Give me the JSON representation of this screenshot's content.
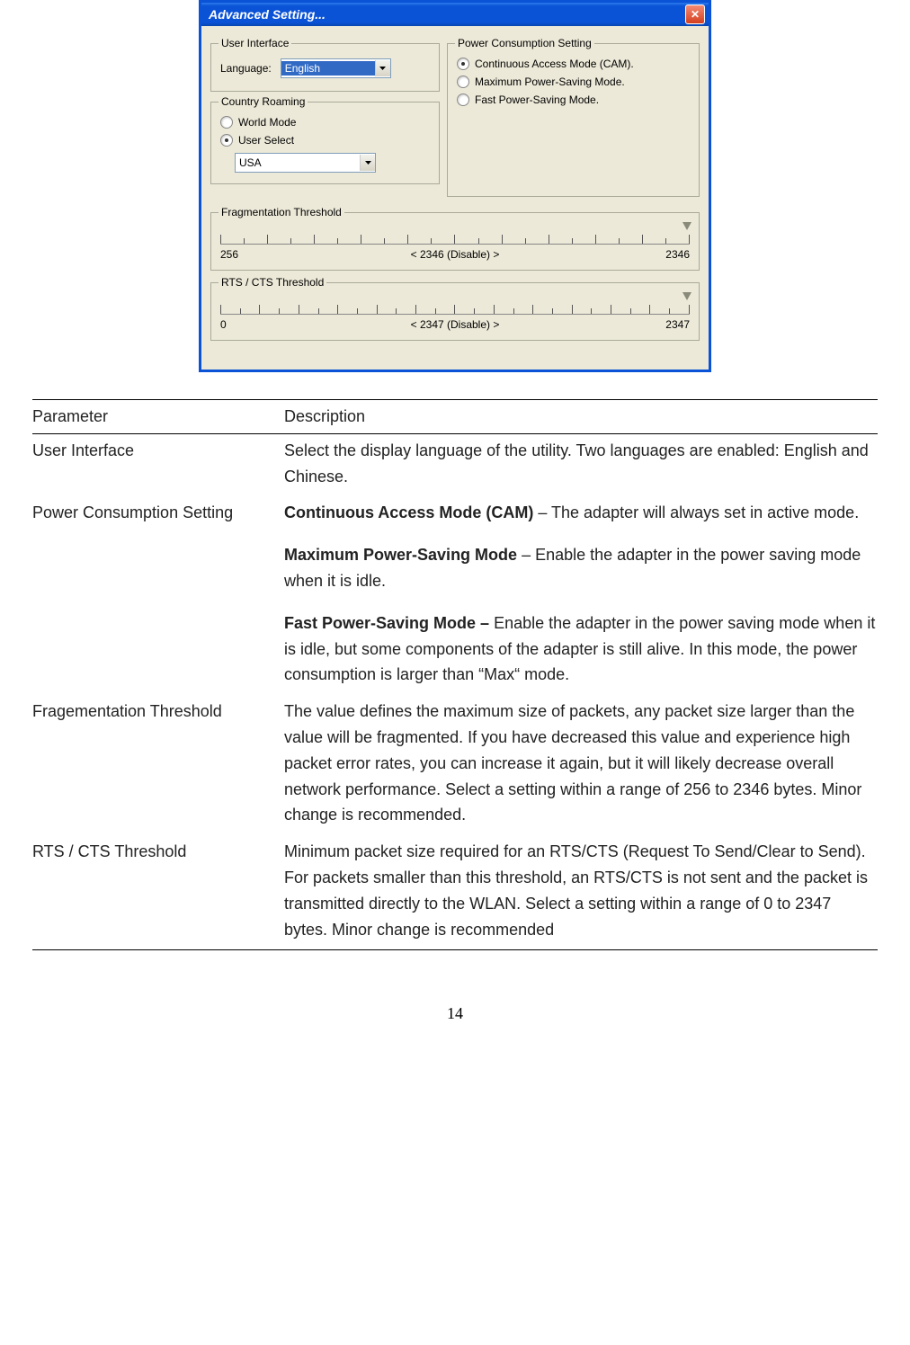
{
  "dialog": {
    "title": "Advanced Setting...",
    "user_interface": {
      "legend": "User Interface",
      "language_label": "Language:",
      "language_value": "English"
    },
    "power_consumption": {
      "legend": "Power Consumption Setting",
      "options": {
        "cam": "Continuous Access Mode (CAM).",
        "max": "Maximum Power-Saving Mode.",
        "fast": "Fast Power-Saving Mode."
      }
    },
    "country_roaming": {
      "legend": "Country Roaming",
      "world": "World Mode",
      "user": "User Select",
      "country_value": "USA"
    },
    "frag": {
      "legend": "Fragmentation Threshold",
      "min": "256",
      "center": "< 2346 (Disable) >",
      "max": "2346"
    },
    "rts": {
      "legend": "RTS / CTS Threshold",
      "min": "0",
      "center": "< 2347 (Disable) >",
      "max": "2347"
    }
  },
  "table": {
    "header": {
      "param": "Parameter",
      "desc": "Description"
    },
    "rows": {
      "ui": {
        "param": "User Interface",
        "desc": "Select the display language of the utility. Two languages are enabled: English and Chinese."
      },
      "power": {
        "param": "Power Consumption Setting",
        "cam_b": "Continuous Access Mode (CAM)",
        "cam_t": " – The adapter will always set in active mode.",
        "max_b": "Maximum Power-Saving Mode",
        "max_t": " – Enable the adapter in the power saving mode when it is idle.",
        "fast_b": "Fast Power-Saving Mode – ",
        "fast_t": "Enable the adapter in the power saving mode when it is idle, but some components of the adapter is still alive. In this mode, the power consumption is larger than “Max“ mode."
      },
      "frag": {
        "param": "Fragementation Threshold",
        "desc": "The value defines the maximum size of packets, any packet size larger than the value will be fragmented. If you have decreased this value and experience high packet error rates, you can increase it again, but it will likely decrease overall network performance. Select a setting within a range of 256 to 2346 bytes. Minor change is recommended."
      },
      "rts": {
        "param": "RTS / CTS Threshold",
        "desc": "Minimum packet size required for an RTS/CTS (Request To Send/Clear to Send). For packets smaller than this threshold, an RTS/CTS is not sent and the packet is transmitted directly to the WLAN. Select a setting within a range of 0 to 2347 bytes. Minor change is recommended"
      }
    }
  },
  "page_number": "14"
}
